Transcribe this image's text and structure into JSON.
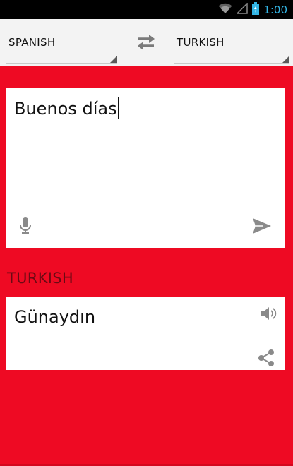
{
  "status_bar": {
    "time": "1:00",
    "icons": [
      "wifi-icon",
      "signal-icon",
      "battery-icon"
    ],
    "time_color": "#33b5e5"
  },
  "language_bar": {
    "source_language": "SPANISH",
    "target_language": "TURKISH",
    "swap_icon": "swap-arrows-icon"
  },
  "input": {
    "text": "Buenos días",
    "icons": [
      "microphone-icon",
      "send-icon"
    ]
  },
  "output": {
    "language_label": "TURKISH",
    "text": "Günaydın",
    "icons": [
      "speaker-icon",
      "share-icon"
    ]
  },
  "colors": {
    "background": "#ee0a23",
    "card": "#ffffff",
    "language_bar": "#f3f3f3",
    "output_label": "#6b0a14"
  }
}
